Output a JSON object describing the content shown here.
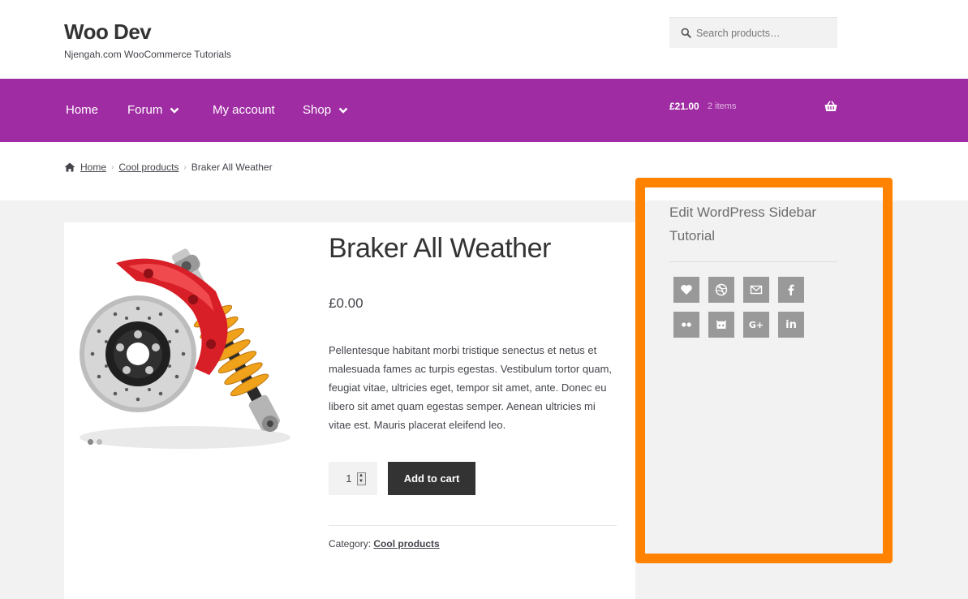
{
  "header": {
    "site_title": "Woo Dev",
    "tagline": "Njengah.com WooCommerce Tutorials",
    "search_placeholder": "Search products…"
  },
  "nav": {
    "items": [
      {
        "label": "Home",
        "has_dropdown": false
      },
      {
        "label": "Forum",
        "has_dropdown": true
      },
      {
        "label": "My account",
        "has_dropdown": false
      },
      {
        "label": "Shop",
        "has_dropdown": true
      }
    ],
    "cart_total": "£21.00",
    "cart_count": "2 items"
  },
  "breadcrumb": {
    "home": "Home",
    "category": "Cool products",
    "current": "Braker All Weather"
  },
  "product": {
    "title": "Braker All Weather",
    "price": "£0.00",
    "description": "Pellentesque habitant morbi tristique senectus et netus et malesuada fames ac turpis egestas. Vestibulum tortor quam, feugiat vitae, ultricies eget, tempor sit amet, ante. Donec eu libero sit amet quam egestas semper. Aenean ultricies mi vitae est. Mauris placerat eleifend leo.",
    "quantity": "1",
    "add_to_cart_label": "Add to cart",
    "category_label": "Category:",
    "category_value": "Cool products"
  },
  "sidebar": {
    "widget_title": "Edit WordPress Sidebar Tutorial",
    "social_icons": [
      "heart-icon",
      "dribbble-icon",
      "email-icon",
      "facebook-icon",
      "flickr-icon",
      "github-icon",
      "google-plus-icon",
      "linkedin-icon"
    ],
    "google_plus_text": "G+",
    "linkedin_text": "in",
    "highlight_color": "#ff8200"
  },
  "colors": {
    "nav_bg": "#a02ca3",
    "button_bg": "#333333",
    "content_bg": "#f2f2f2",
    "social_bg": "#999999"
  }
}
